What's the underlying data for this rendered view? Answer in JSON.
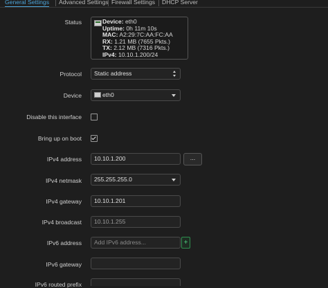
{
  "tabs": [
    {
      "label": "General Settings",
      "active": true
    },
    {
      "label": "Advanced Settings",
      "active": false
    },
    {
      "label": "Firewall Settings",
      "active": false
    },
    {
      "label": "DHCP Server",
      "active": false
    }
  ],
  "status": {
    "label": "Status",
    "device_key": "Device:",
    "device_val": "eth0",
    "uptime_key": "Uptime:",
    "uptime_val": "0h 11m 10s",
    "mac_key": "MAC:",
    "mac_val": "A2:29:7C:AA:FC:AA",
    "rx_key": "RX:",
    "rx_val": "1.21 MB (7655 Pkts.)",
    "tx_key": "TX:",
    "tx_val": "2.12 MB (7316 Pkts.)",
    "ipv4_key": "IPv4:",
    "ipv4_val": "10.10.1.200/24"
  },
  "protocol": {
    "label": "Protocol",
    "value": "Static address"
  },
  "device": {
    "label": "Device",
    "value": "eth0"
  },
  "disable_interface": {
    "label": "Disable this interface",
    "checked": false
  },
  "bring_up": {
    "label": "Bring up on boot",
    "checked": true
  },
  "ipv4_address": {
    "label": "IPv4 address",
    "value": "10.10.1.200",
    "button": "..."
  },
  "ipv4_netmask": {
    "label": "IPv4 netmask",
    "value": "255.255.255.0"
  },
  "ipv4_gateway": {
    "label": "IPv4 gateway",
    "value": "10.10.1.201"
  },
  "ipv4_broadcast": {
    "label": "IPv4 broadcast",
    "placeholder": "10.10.1.255"
  },
  "ipv6_address": {
    "label": "IPv6 address",
    "placeholder": "Add IPv6 address...",
    "button": "+"
  },
  "ipv6_gateway": {
    "label": "IPv6 gateway",
    "value": ""
  },
  "ipv6_routed_prefix": {
    "label": "IPv6 routed prefix"
  }
}
